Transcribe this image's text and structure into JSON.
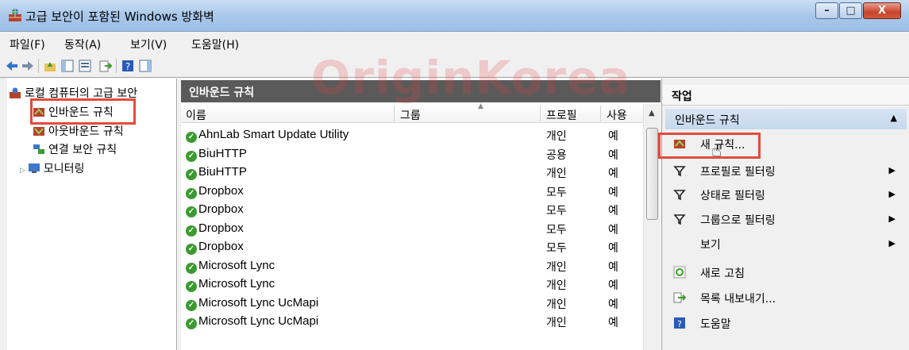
{
  "window": {
    "title": "고급 보안이 포함된 Windows 방화벽",
    "minimize_glyph": "–",
    "maximize_glyph": "□",
    "close_glyph": "X"
  },
  "menu": [
    "파일(F)",
    "동작(A)",
    "보기(V)",
    "도움말(H)"
  ],
  "watermark": "OriginKorea",
  "tree": {
    "root": "로컬 컴퓨터의 고급 보안",
    "items": [
      "인바운드 규칙",
      "아웃바운드 규칙",
      "연결 보안 규칙",
      "모니터링"
    ]
  },
  "rules": {
    "header": "인바운드 규칙",
    "columns": {
      "name": "이름",
      "group": "그룹",
      "profile": "프로필",
      "enabled": "사용"
    },
    "rows": [
      {
        "name": "AhnLab Smart Update Utility",
        "profile": "개인",
        "enabled": "예"
      },
      {
        "name": "BiuHTTP",
        "profile": "공용",
        "enabled": "예"
      },
      {
        "name": "BiuHTTP",
        "profile": "개인",
        "enabled": "예"
      },
      {
        "name": "Dropbox",
        "profile": "모두",
        "enabled": "예"
      },
      {
        "name": "Dropbox",
        "profile": "모두",
        "enabled": "예"
      },
      {
        "name": "Dropbox",
        "profile": "모두",
        "enabled": "예"
      },
      {
        "name": "Dropbox",
        "profile": "모두",
        "enabled": "예"
      },
      {
        "name": "Microsoft Lync",
        "profile": "개인",
        "enabled": "예"
      },
      {
        "name": "Microsoft Lync",
        "profile": "개인",
        "enabled": "예"
      },
      {
        "name": "Microsoft Lync UcMapi",
        "profile": "개인",
        "enabled": "예"
      },
      {
        "name": "Microsoft Lync UcMapi",
        "profile": "개인",
        "enabled": "예"
      }
    ]
  },
  "actions": {
    "title": "작업",
    "section": "인바운드 규칙",
    "items": [
      {
        "label": "새 규칙...",
        "icon": "new-rule-icon"
      },
      {
        "label": "프로필로 필터링",
        "icon": "filter-icon"
      },
      {
        "label": "상태로 필터링",
        "icon": "filter-icon"
      },
      {
        "label": "그룹으로 필터링",
        "icon": "filter-icon"
      },
      {
        "label": "보기",
        "icon": ""
      },
      {
        "label": "새로 고침",
        "icon": "refresh-icon"
      },
      {
        "label": "목록 내보내기...",
        "icon": "export-icon"
      },
      {
        "label": "도움말",
        "icon": "help-icon"
      }
    ]
  },
  "colors": {
    "highlight_border": "#e34b3b",
    "rules_header_bg": "#5a5a5a",
    "action_section_bg": "#c5d8ec",
    "enabled_check": "#3a9b2e"
  }
}
